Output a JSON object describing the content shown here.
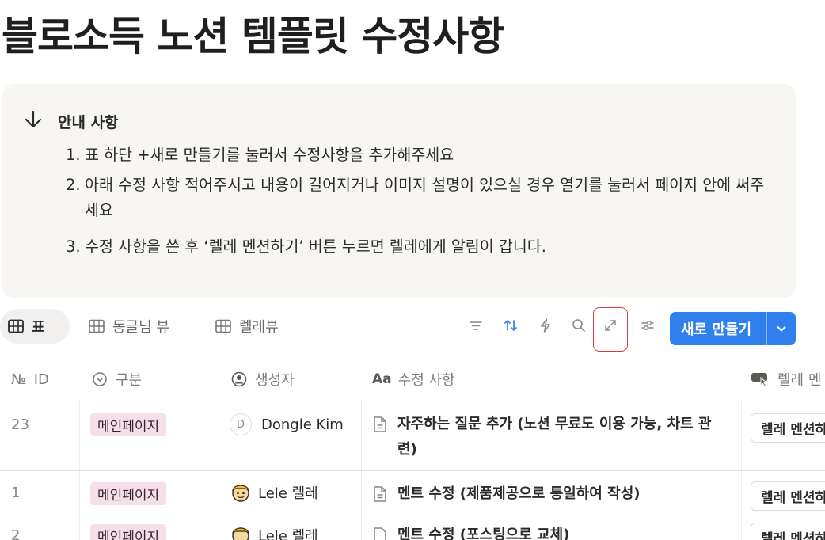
{
  "page": {
    "title": "블로소득 노션 템플릿 수정사항"
  },
  "callout": {
    "title": "안내 사항",
    "items": [
      {
        "num": "1.",
        "text": "표 하단 +새로 만들기를 눌러서 수정사항을 추가해주세요"
      },
      {
        "num": "2.",
        "text": "아래 수정 사항 적어주시고 내용이 길어지거나 이미지 설명이 있으실 경우 열기를 눌러서 페이지 안에 써주세요"
      },
      {
        "num": "3.",
        "text": "수정 사항을 쓴 후 ‘렐레 멘션하기’ 버튼 누르면 렐레에게 알림이 갑니다."
      }
    ]
  },
  "toolbar": {
    "views": [
      {
        "label": "표"
      },
      {
        "label": "동글님 뷰"
      },
      {
        "label": "렐레뷰"
      }
    ],
    "new_button": "새로 만들기"
  },
  "table": {
    "columns": [
      "ID",
      "구분",
      "생성자",
      "수정 사항",
      "렐레 멘"
    ],
    "id_prefix": "№",
    "rows": [
      {
        "id": "23",
        "category": "메인페이지",
        "author_initial": "D",
        "author": "Dongle Kim",
        "title": "자주하는 질문 추가 (노션 무료도 이용 가능, 차트 관련)",
        "action": "렐레 멘션하기"
      },
      {
        "id": "1",
        "category": "메인페이지",
        "author": "Lele 렐레",
        "title": "멘트 수정 (제품제공으로 통일하여 작성)",
        "action": "렐레 멘션하기"
      },
      {
        "id": "2",
        "category": "메인페이지",
        "author": "Lele 렐레",
        "title": "멘트 수정 (포스팅으로 교체)",
        "action": "렐레 멘션하기"
      }
    ]
  }
}
